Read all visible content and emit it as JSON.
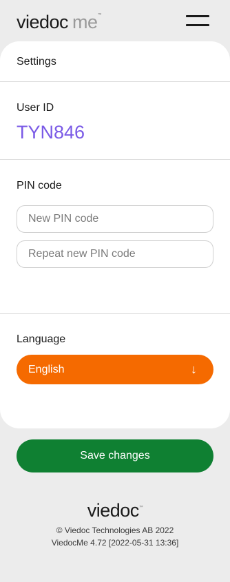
{
  "header": {
    "logo_main": "viedoc",
    "logo_sub": "me",
    "logo_tm": "™"
  },
  "settings": {
    "title": "Settings",
    "user_id_label": "User ID",
    "user_id_value": "TYN846",
    "pin_label": "PIN code",
    "new_pin_placeholder": "New PIN code",
    "repeat_pin_placeholder": "Repeat new PIN code",
    "language_label": "Language",
    "language_value": "English",
    "language_arrow": "↓"
  },
  "actions": {
    "save_label": "Save changes"
  },
  "footer": {
    "logo": "viedoc",
    "logo_tm": "™",
    "copyright": "© Viedoc Technologies AB 2022",
    "version": "ViedocMe 4.72 [2022-05-31 13:36]"
  },
  "colors": {
    "background": "#ececec",
    "card": "#ffffff",
    "user_id": "#7a5ae6",
    "language_select": "#f56a00",
    "save_button": "#0f8032"
  },
  "icons": {
    "menu": "hamburger-menu-icon",
    "dropdown": "arrow-down-icon"
  }
}
